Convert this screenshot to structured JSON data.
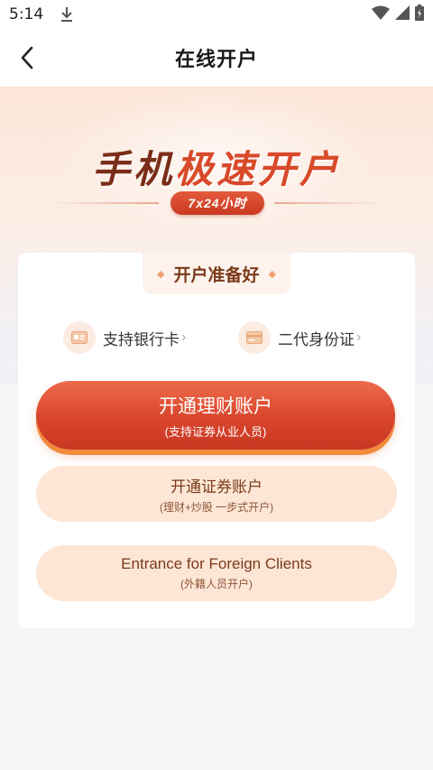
{
  "status_bar": {
    "time": "5:14"
  },
  "nav": {
    "title": "在线开户"
  },
  "hero": {
    "title_part1": "手机",
    "title_part2": "极速开户",
    "badge": "7x24小时"
  },
  "card": {
    "prep_label": "开户准备好",
    "requirements": [
      {
        "label": "支持银行卡",
        "icon": "bank-card-icon"
      },
      {
        "label": "二代身份证",
        "icon": "id-card-icon"
      }
    ],
    "buttons": [
      {
        "main": "开通理财账户",
        "sub": "(支持证券从业人员)"
      },
      {
        "main": "开通证券账户",
        "sub": "(理财+炒股 一步式开户)"
      },
      {
        "main": "Entrance for Foreign Clients",
        "sub": "(外籍人员开户)"
      }
    ]
  },
  "colors": {
    "primary": "#d9452c",
    "accent_orange": "#f28a3c",
    "secondary_bg": "#fde6d6",
    "brown_text": "#7a3a1a"
  }
}
